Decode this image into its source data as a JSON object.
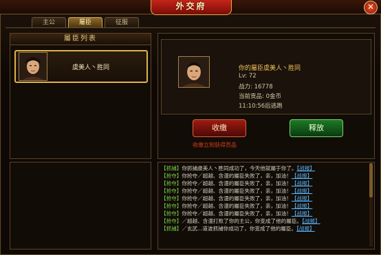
{
  "window": {
    "title": "外交府",
    "close_glyph": "✕"
  },
  "tabs": [
    {
      "label": "主公"
    },
    {
      "label": "屬臣"
    },
    {
      "label": "征服"
    }
  ],
  "left_panel": {
    "header": "屬臣列表",
    "items": [
      {
        "name": "虞美人丶胜同"
      }
    ]
  },
  "detail": {
    "title": "你的屬臣虞美人丶胜同",
    "level": "Lv: 72",
    "power": "战力: 16778",
    "tribute": "当前贡品: 0金币",
    "escape": "11:10:56后逃跑"
  },
  "buttons": {
    "tax": "收缴",
    "release": "释放"
  },
  "tax_hint": "收缴立刻获得贡品",
  "log": [
    {
      "tag": "【抓捕】",
      "text": "你抓捕虞美人丶胜同成功了，今天他就屬于你了。",
      "report": "【战报】"
    },
    {
      "tag": "【抢夺】",
      "text": "你抢夺／超越、含漫的屬臣失败了，亲，加油！",
      "report": "【战报】"
    },
    {
      "tag": "【抢夺】",
      "text": "你抢夺／超越、含漫的屬臣失败了，亲，加油！",
      "report": "【战报】"
    },
    {
      "tag": "【抢夺】",
      "text": "你抢夺／超越、含漫的屬臣失败了，亲，加油！",
      "report": "【战报】"
    },
    {
      "tag": "【抢夺】",
      "text": "你抢夺／超越、含漫的屬臣失败了，亲，加油！",
      "report": "【战报】"
    },
    {
      "tag": "【抢夺】",
      "text": "你抢夺／超越、含漫的屬臣失败了，亲，加油！",
      "report": "【战报】"
    },
    {
      "tag": "【抢夺】",
      "text": "你抢夺／超越、含漫的屬臣失败了，亲，加油！",
      "report": "【战报】"
    },
    {
      "tag": "【抢夺】",
      "text": "／超越、含漫打败了你的主公，你变成了他的屬臣。",
      "report": "【战报】"
    },
    {
      "tag": "【抓捕】",
      "text": "／玄武...道波抓捕你成功了，你变成了他的屬臣。",
      "report": "【战报】"
    }
  ],
  "colors": {
    "accent": "#e0b44a",
    "tag": "#78d24a",
    "link": "#5ab8ff",
    "danger": "#d63c20"
  }
}
